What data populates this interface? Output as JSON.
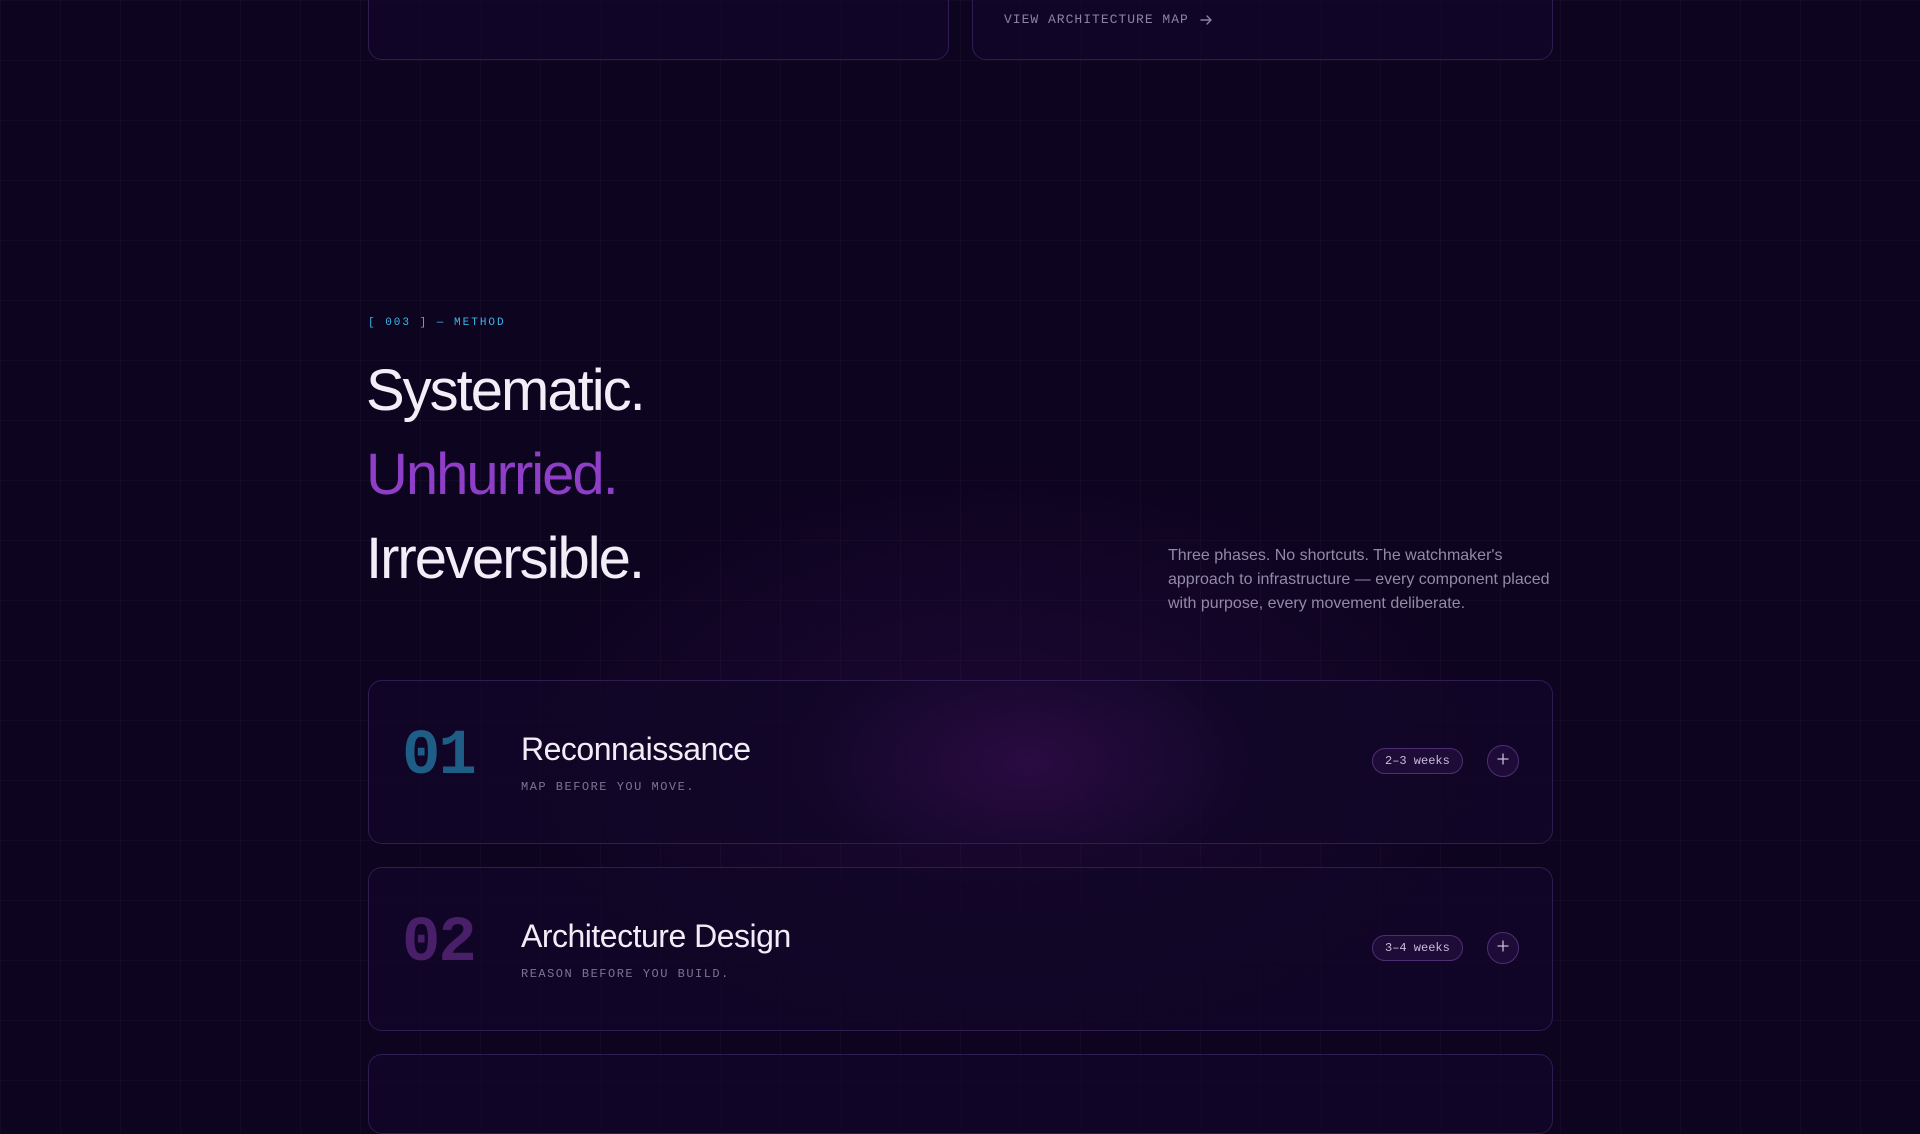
{
  "top_cards": {
    "architecture_link": {
      "label": "VIEW ARCHITECTURE MAP",
      "icon": "arrow-right-icon"
    }
  },
  "method": {
    "eyebrow": "[ 003 ] — METHOD",
    "headline": [
      "Systematic.",
      "Unhurried.",
      "Irreversible."
    ],
    "intro": "Three phases. No shortcuts. The watchmaker's approach to infrastructure — every component placed with purpose, every movement deliberate.",
    "phases": [
      {
        "number": "01",
        "title": "Reconnaissance",
        "subtitle": "MAP BEFORE YOU MOVE.",
        "duration": "2–3 weeks",
        "expand_icon": "plus-icon"
      },
      {
        "number": "02",
        "title": "Architecture Design",
        "subtitle": "REASON BEFORE YOU BUILD.",
        "duration": "3–4 weeks",
        "expand_icon": "plus-icon"
      }
    ]
  },
  "colors": {
    "background": "#0d0420",
    "accent_purple": "#8f3fc7",
    "accent_cyan": "#3db6e6",
    "card_border": "#2e1d50"
  }
}
